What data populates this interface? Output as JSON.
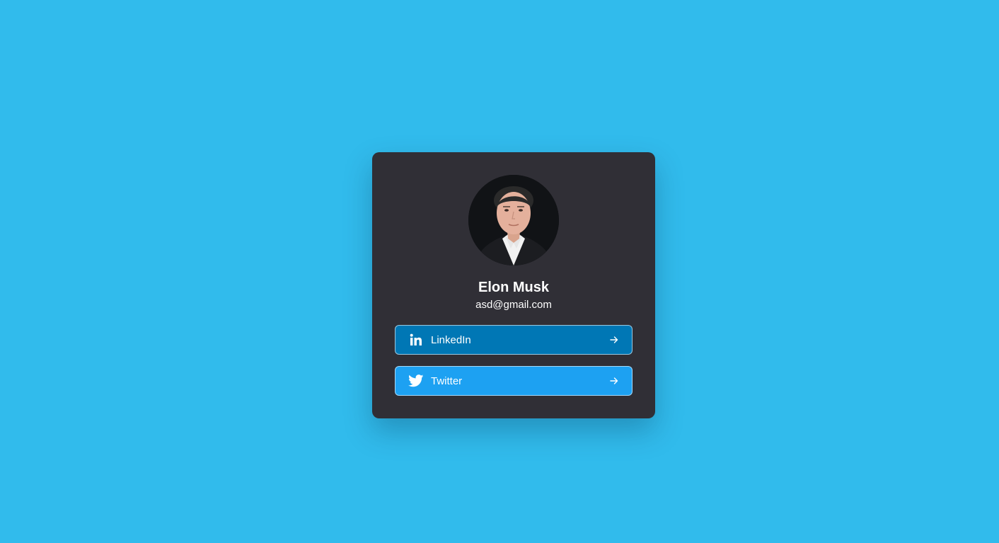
{
  "theme": {
    "background": "#31bbec",
    "card": "#302f36",
    "text": "#ffffff"
  },
  "profile": {
    "name": "Elon Musk",
    "email": "asd@gmail.com",
    "avatar_icon": "profile-photo"
  },
  "links": [
    {
      "label": "LinkedIn",
      "icon": "linkedin-icon",
      "color": "#0077b5",
      "action_icon": "arrow-right-icon"
    },
    {
      "label": "Twitter",
      "icon": "twitter-icon",
      "color": "#1da1f2",
      "action_icon": "arrow-right-icon"
    }
  ]
}
